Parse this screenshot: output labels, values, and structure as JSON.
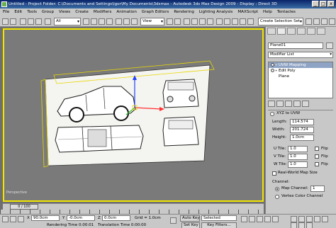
{
  "titlebar": {
    "text": "Untitled   - Project Folder: C:\\Documents and Settings\\Igor\\My Documents\\3dsmax   - Autodesk 3ds Max Design 2009   - Display : Direct 3D",
    "min": "_",
    "max": "□",
    "close": "x"
  },
  "menu": [
    "File",
    "Edit",
    "Tools",
    "Group",
    "Views",
    "Create",
    "Modifiers",
    "Animation",
    "Graph Editors",
    "Rendering",
    "Lighting Analysis",
    "MAXScript",
    "Help",
    "Tentacles"
  ],
  "toolbar": {
    "filter_value": "All",
    "view_value": "View",
    "selection_set_placeholder": "Create Selection Set"
  },
  "viewport": {
    "label": "Perspective"
  },
  "timeline": {
    "frame": "0 / 100"
  },
  "status": {
    "x_label": "X",
    "x_value": "90.0cm",
    "y_label": "Y",
    "y_value": "-0.0cm",
    "z_label": "Z",
    "z_value": "0.0cm",
    "grid_value": "Grid = 1.0cm",
    "auto_key": "Auto Key",
    "selected": "Selected",
    "set_key": "Set Key",
    "key_filters": "Key Filters...",
    "render_time": "Rendering Time  0:00:01",
    "translation_time": "Translation Time  0:00:00"
  },
  "command_panel": {
    "object_name": "Plane01",
    "modifier_list": "Modifier List",
    "stack": [
      {
        "label": "UVW Mapping",
        "selected": true
      },
      {
        "label": "Edit Poly",
        "selected": false
      },
      {
        "label": "Plane",
        "selected": false
      }
    ],
    "params": {
      "xyz_to_uvw": "XYZ to UVW",
      "length_label": "Length:",
      "length_value": "114.574",
      "width_label": "Width:",
      "width_value": "201.724",
      "height_label": "Height:",
      "height_value": "1.0cm",
      "u_tile_label": "U Tile:",
      "u_tile_value": "1.0",
      "v_tile_label": "V Tile:",
      "v_tile_value": "1.0",
      "w_tile_label": "W Tile:",
      "w_tile_value": "1.0",
      "flip": "Flip",
      "real_world": "Real-World Map Size",
      "channel_title": "Channel:",
      "map_channel_label": "Map Channel:",
      "map_channel_value": "1",
      "vertex_color": "Vertex Color Channel"
    }
  }
}
